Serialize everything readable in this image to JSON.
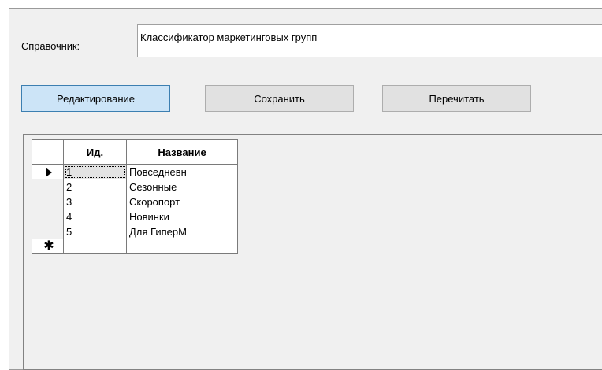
{
  "reference": {
    "label": "Справочник:",
    "value": "Классификатор маркетинговых групп"
  },
  "toolbar": {
    "edit_label": "Редактирование",
    "save_label": "Сохранить",
    "reload_label": "Перечитать"
  },
  "grid": {
    "columns": [
      "Ид.",
      "Название"
    ],
    "rows": [
      {
        "id": "1",
        "name": "Повседневн"
      },
      {
        "id": "2",
        "name": "Сезонные"
      },
      {
        "id": "3",
        "name": "Скоропорт"
      },
      {
        "id": "4",
        "name": "Новинки"
      },
      {
        "id": "5",
        "name": "Для ГиперМ"
      }
    ],
    "current_row_marker": "▶",
    "new_row_marker": "✱"
  }
}
